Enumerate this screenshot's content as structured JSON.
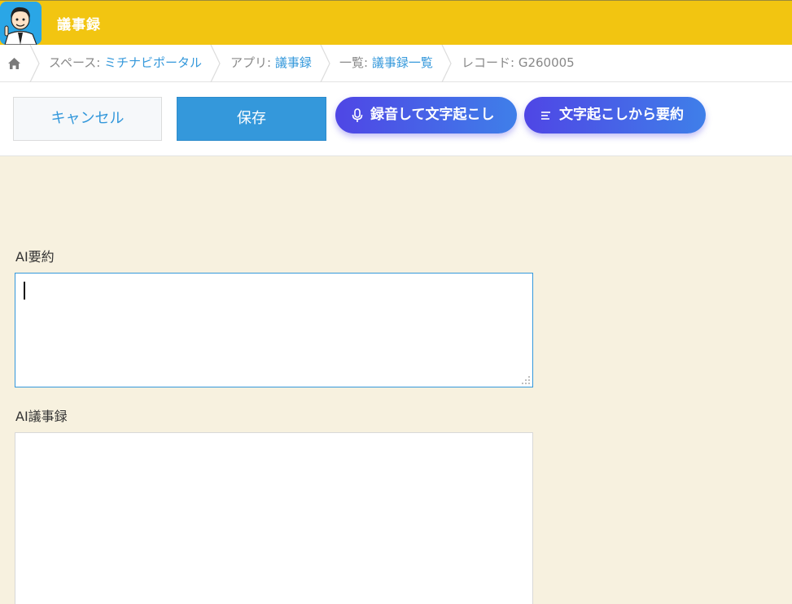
{
  "header": {
    "app_title": "議事録"
  },
  "breadcrumb": {
    "items": [
      {
        "prefix": "スペース: ",
        "value": "ミチナビポータル"
      },
      {
        "prefix": "アプリ: ",
        "value": "議事録"
      },
      {
        "prefix": "一覧: ",
        "value": "議事録一覧"
      },
      {
        "prefix": "レコード: ",
        "value": "G260005"
      }
    ]
  },
  "toolbar": {
    "cancel_label": "キャンセル",
    "save_label": "保存",
    "record_label": "録音して文字起こし",
    "summary_label": "文字起こしから要約"
  },
  "form": {
    "fields": [
      {
        "label": "AI要約",
        "value": ""
      },
      {
        "label": "AI議事録",
        "value": ""
      }
    ]
  },
  "colors": {
    "header_bg": "#f2c511",
    "accent_blue": "#3498db",
    "pill_gradient_start": "#4f46e5",
    "pill_gradient_end": "#3f7fe9",
    "page_bg": "#f7f1df"
  },
  "icons": {
    "home": "home-icon",
    "microphone": "microphone-icon",
    "text_lines": "text-lines-icon",
    "logo": "app-logo-icon"
  }
}
